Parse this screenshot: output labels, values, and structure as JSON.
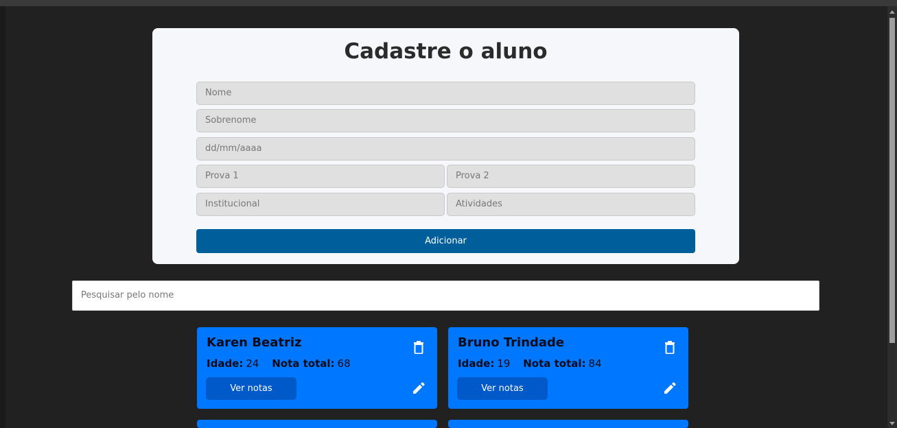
{
  "form": {
    "title": "Cadastre o aluno",
    "fields": {
      "nome": {
        "placeholder": "Nome",
        "value": ""
      },
      "sobrenome": {
        "placeholder": "Sobrenome",
        "value": ""
      },
      "data_nascimento": {
        "placeholder": "dd/mm/aaaa",
        "value": ""
      },
      "prova1": {
        "placeholder": "Prova 1",
        "value": ""
      },
      "prova2": {
        "placeholder": "Prova 2",
        "value": ""
      },
      "institucional": {
        "placeholder": "Institucional",
        "value": ""
      },
      "atividades": {
        "placeholder": "Atividades",
        "value": ""
      }
    },
    "submit_label": "Adicionar"
  },
  "search": {
    "placeholder": "Pesquisar pelo nome",
    "value": ""
  },
  "labels": {
    "idade": "Idade:",
    "nota_total": "Nota total:",
    "ver_notas": "Ver notas"
  },
  "students": [
    {
      "name": "Karen Beatriz",
      "idade": "24",
      "nota_total": "68"
    },
    {
      "name": "Bruno Trindade",
      "idade": "19",
      "nota_total": "84"
    }
  ],
  "icons": {
    "delete": "trash-icon",
    "edit": "pencil-icon"
  },
  "colors": {
    "page_bg": "#212121",
    "form_bg": "#f6f7fb",
    "primary_button": "#005f9b",
    "card_bg": "#0077ff",
    "card_button": "#0059c8"
  }
}
